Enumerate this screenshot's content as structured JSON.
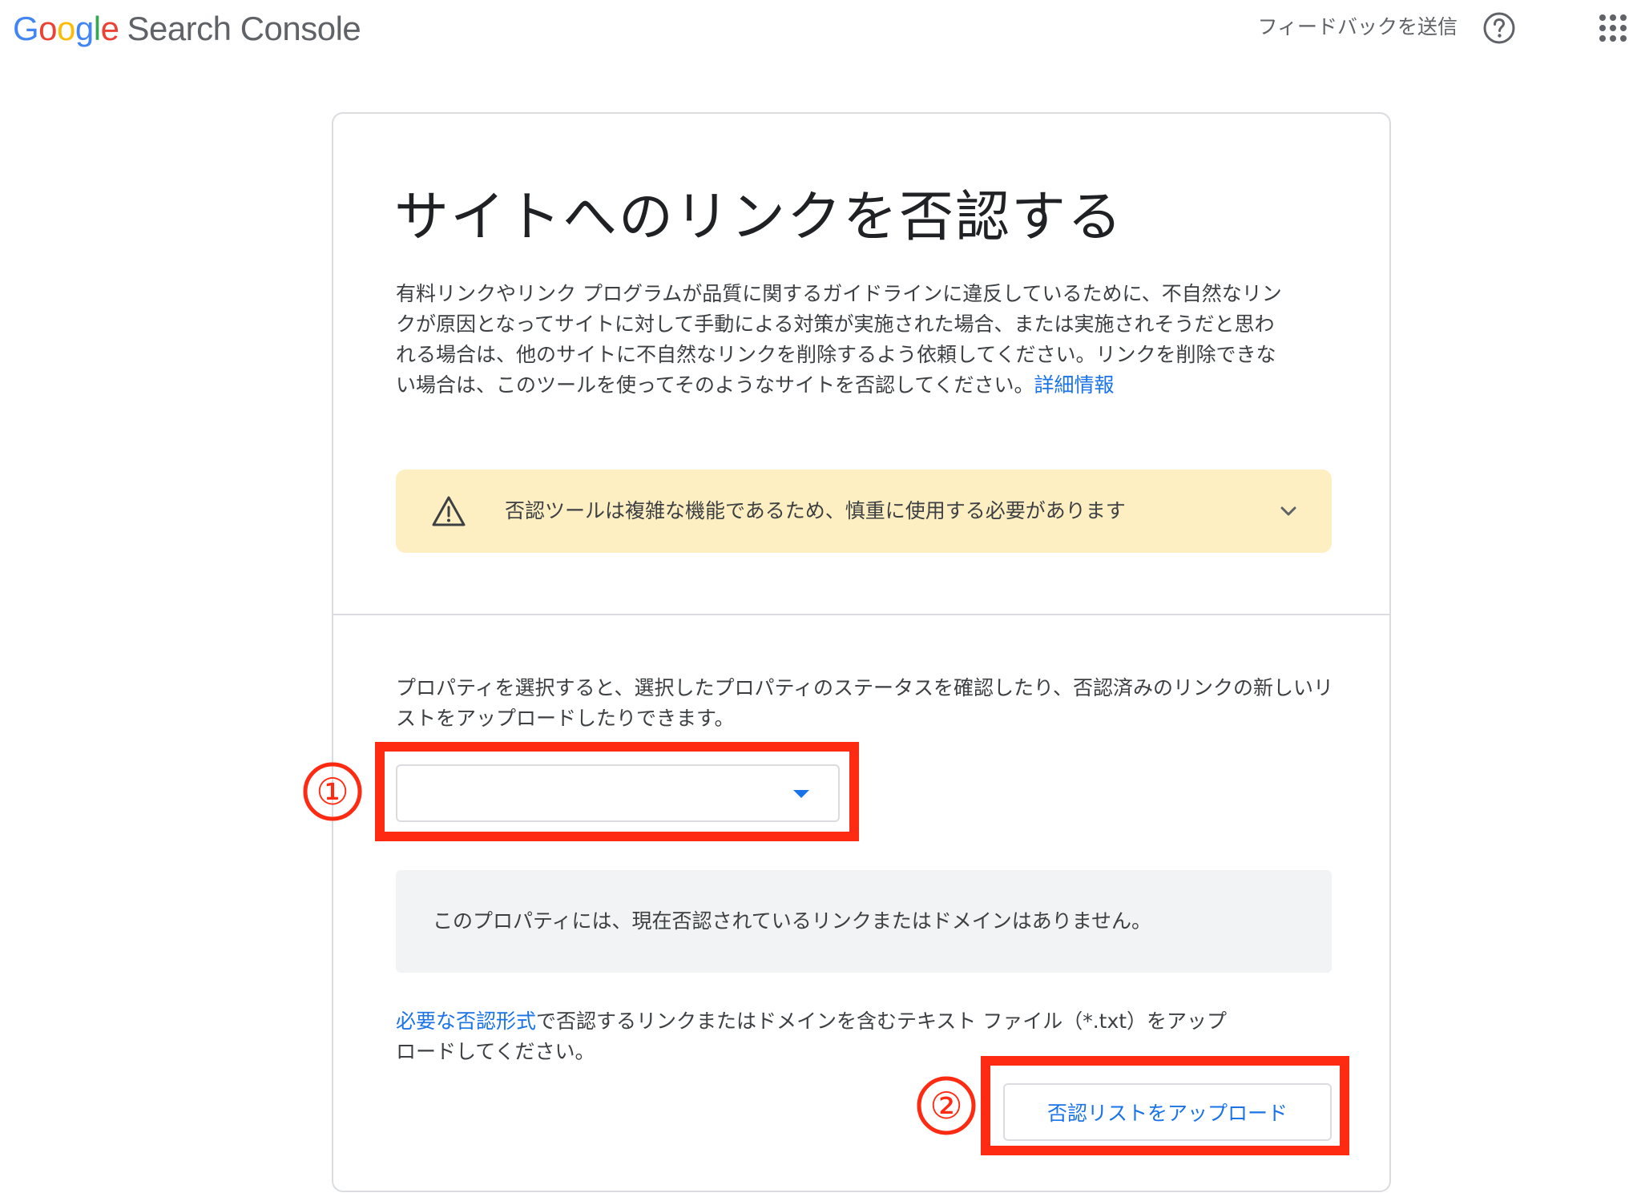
{
  "header": {
    "logo": {
      "google_letters": [
        {
          "char": "G",
          "color": "#4285F4"
        },
        {
          "char": "o",
          "color": "#EA4335"
        },
        {
          "char": "o",
          "color": "#FBBC05"
        },
        {
          "char": "g",
          "color": "#4285F4"
        },
        {
          "char": "l",
          "color": "#34A853"
        },
        {
          "char": "e",
          "color": "#EA4335"
        }
      ],
      "product": "Search Console"
    },
    "feedback_label": "フィードバックを送信",
    "help_icon": "help-circle-icon",
    "apps_icon": "apps-grid-icon"
  },
  "main": {
    "title": "サイトへのリンクを否認する",
    "intro_text": "有料リンクやリンク プログラムが品質に関するガイドラインに違反しているために、不自然なリンクが原因となってサイトに対して手動による対策が実施された場合、または実施されそうだと思われる場合は、他のサイトに不自然なリンクを削除するよう依頼してください。リンクを削除できない場合は、このツールを使ってそのようなサイトを否認してください。",
    "learn_more_link": "詳細情報",
    "warning": {
      "icon": "warning-triangle-icon",
      "text": "否認ツールは複雑な機能であるため、慎重に使用する必要があります",
      "expand_icon": "chevron-down-icon"
    },
    "property_description": "プロパティを選択すると、選択したプロパティのステータスを確認したり、否認済みのリンクの新しいリストをアップロードしたりできます。",
    "property_select": {
      "value": "",
      "arrow_icon": "dropdown-arrow-icon"
    },
    "empty_status": "このプロパティには、現在否認されているリンクまたはドメインはありません。",
    "upload_description": {
      "link_text": "必要な否認形式",
      "text": "で否認するリンクまたはドメインを含むテキスト ファイル（*.txt）をアップロードしてください。"
    },
    "upload_button_label": "否認リストをアップロード"
  },
  "annotations": {
    "color": "#ff2a12",
    "markers": [
      "①",
      "②"
    ]
  },
  "colors": {
    "link_blue": "#1a73e8",
    "warning_bg": "#feefc3",
    "status_bg": "#f1f3f4",
    "border": "#dadce0"
  }
}
